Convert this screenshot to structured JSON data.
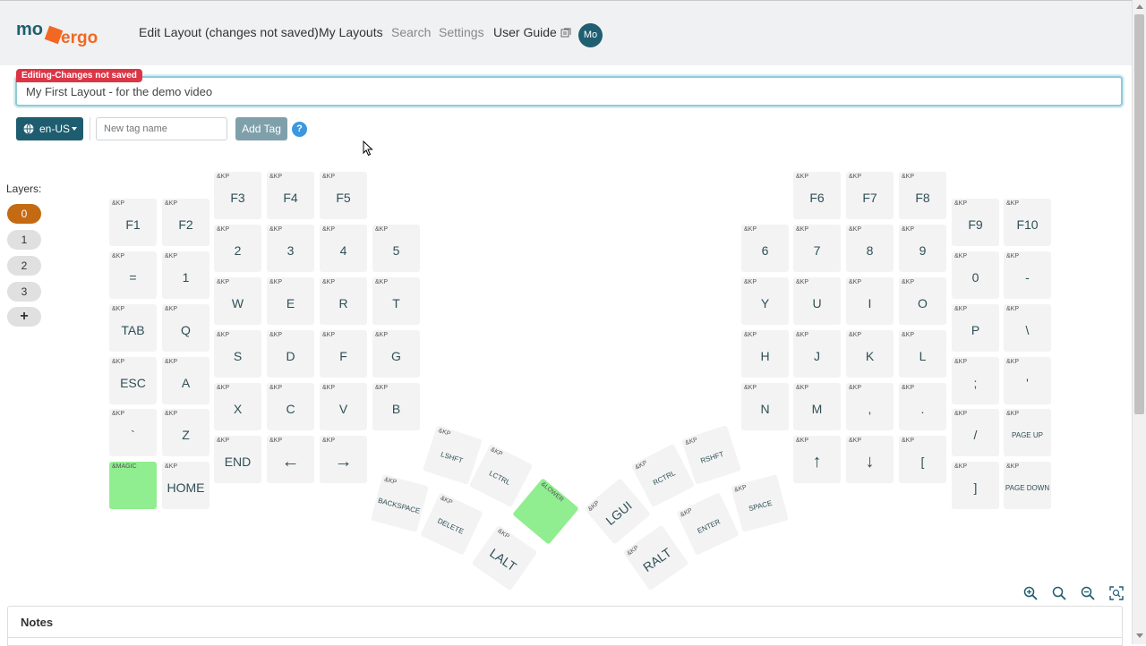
{
  "logo": {
    "part1": "mo",
    "part2": "ergo"
  },
  "nav": [
    {
      "label": "Edit Layout (changes not saved)",
      "name": "nav-edit-layout"
    },
    {
      "label": "My Layouts",
      "name": "nav-my-layouts"
    },
    {
      "label": "Search",
      "name": "nav-search"
    },
    {
      "label": "Settings",
      "name": "nav-settings"
    },
    {
      "label": "User Guide",
      "name": "nav-user-guide"
    }
  ],
  "avatar": "Mo",
  "editing_badge": "Editing-Changes not saved",
  "layout_name": "My First Layout - for the demo video",
  "locale": "en-US",
  "tag_placeholder": "New tag name",
  "add_tag": "Add Tag",
  "help": "?",
  "layers_label": "Layers:",
  "layers": [
    "0",
    "1",
    "2",
    "3",
    "+"
  ],
  "active_layer": "0",
  "keys": [
    {
      "kp": "&KP",
      "label": "F3"
    },
    {
      "kp": "&KP",
      "label": "F4"
    },
    {
      "kp": "&KP",
      "label": "F5"
    },
    {
      "kp": "&KP",
      "label": "F1"
    },
    {
      "kp": "&KP",
      "label": "F2"
    },
    {
      "kp": "&KP",
      "label": "2"
    },
    {
      "kp": "&KP",
      "label": "3"
    },
    {
      "kp": "&KP",
      "label": "4"
    },
    {
      "kp": "&KP",
      "label": "5"
    },
    {
      "kp": "&KP",
      "label": "="
    },
    {
      "kp": "&KP",
      "label": "1"
    },
    {
      "kp": "&KP",
      "label": "W"
    },
    {
      "kp": "&KP",
      "label": "E"
    },
    {
      "kp": "&KP",
      "label": "R"
    },
    {
      "kp": "&KP",
      "label": "T"
    },
    {
      "kp": "&KP",
      "label": "TAB"
    },
    {
      "kp": "&KP",
      "label": "Q"
    },
    {
      "kp": "&KP",
      "label": "S"
    },
    {
      "kp": "&KP",
      "label": "D"
    },
    {
      "kp": "&KP",
      "label": "F"
    },
    {
      "kp": "&KP",
      "label": "G"
    },
    {
      "kp": "&KP",
      "label": "ESC"
    },
    {
      "kp": "&KP",
      "label": "A"
    },
    {
      "kp": "&KP",
      "label": "X"
    },
    {
      "kp": "&KP",
      "label": "C"
    },
    {
      "kp": "&KP",
      "label": "V"
    },
    {
      "kp": "&KP",
      "label": "B"
    },
    {
      "kp": "&KP",
      "label": "`"
    },
    {
      "kp": "&KP",
      "label": "Z"
    },
    {
      "kp": "&KP",
      "label": "END"
    },
    {
      "kp": "&KP",
      "label": "←"
    },
    {
      "kp": "&KP",
      "label": "→"
    },
    {
      "kp": "&MAGIC",
      "label": ""
    },
    {
      "kp": "&KP",
      "label": "HOME"
    },
    {
      "kp": "&KP",
      "label": "LSHFT"
    },
    {
      "kp": "&KP",
      "label": "LCTRL"
    },
    {
      "kp": "&LOWER",
      "label": ""
    },
    {
      "kp": "&KP",
      "label": "BACKSPACE"
    },
    {
      "kp": "&KP",
      "label": "DELETE"
    },
    {
      "kp": "&KP",
      "label": "LALT"
    },
    {
      "kp": "&KP",
      "label": "F6"
    },
    {
      "kp": "&KP",
      "label": "F7"
    },
    {
      "kp": "&KP",
      "label": "F8"
    },
    {
      "kp": "&KP",
      "label": "F9"
    },
    {
      "kp": "&KP",
      "label": "F10"
    },
    {
      "kp": "&KP",
      "label": "6"
    },
    {
      "kp": "&KP",
      "label": "7"
    },
    {
      "kp": "&KP",
      "label": "8"
    },
    {
      "kp": "&KP",
      "label": "9"
    },
    {
      "kp": "&KP",
      "label": "0"
    },
    {
      "kp": "&KP",
      "label": "-"
    },
    {
      "kp": "&KP",
      "label": "Y"
    },
    {
      "kp": "&KP",
      "label": "U"
    },
    {
      "kp": "&KP",
      "label": "I"
    },
    {
      "kp": "&KP",
      "label": "O"
    },
    {
      "kp": "&KP",
      "label": "P"
    },
    {
      "kp": "&KP",
      "label": "\\"
    },
    {
      "kp": "&KP",
      "label": "H"
    },
    {
      "kp": "&KP",
      "label": "J"
    },
    {
      "kp": "&KP",
      "label": "K"
    },
    {
      "kp": "&KP",
      "label": "L"
    },
    {
      "kp": "&KP",
      "label": ";"
    },
    {
      "kp": "&KP",
      "label": "'"
    },
    {
      "kp": "&KP",
      "label": "N"
    },
    {
      "kp": "&KP",
      "label": "M"
    },
    {
      "kp": "&KP",
      "label": ","
    },
    {
      "kp": "&KP",
      "label": "."
    },
    {
      "kp": "&KP",
      "label": "/"
    },
    {
      "kp": "&KP",
      "label": "PAGE UP"
    },
    {
      "kp": "&KP",
      "label": "↑"
    },
    {
      "kp": "&KP",
      "label": "↓"
    },
    {
      "kp": "&KP",
      "label": "["
    },
    {
      "kp": "&KP",
      "label": "]"
    },
    {
      "kp": "&KP",
      "label": "PAGE DOWN"
    },
    {
      "kp": "&KP",
      "label": "RSHFT"
    },
    {
      "kp": "&KP",
      "label": "RCTRL"
    },
    {
      "kp": "&KP",
      "label": "LGUI"
    },
    {
      "kp": "&KP",
      "label": "SPACE"
    },
    {
      "kp": "&KP",
      "label": "ENTER"
    },
    {
      "kp": "&KP",
      "label": "RALT"
    }
  ],
  "notes_title": "Notes",
  "colors": {
    "accent": "#1e5d6f",
    "active_layer": "#c46a12",
    "green_key": "#90ee90",
    "badge": "#dc3545"
  },
  "icons": {
    "locale": "globe-icon",
    "user_guide": "external-doc-icon",
    "zoom_in": "zoom-in-icon",
    "zoom_out": "zoom-out-icon",
    "zoom_out_2": "zoom-out-icon",
    "fit": "fit-screen-icon"
  }
}
